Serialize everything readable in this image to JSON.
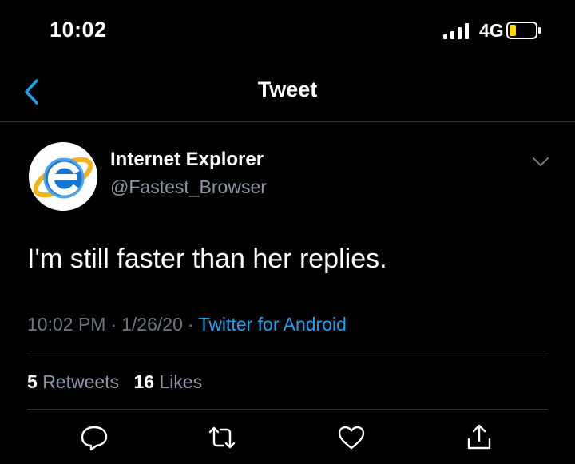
{
  "status_bar": {
    "time": "10:02",
    "network": "4G"
  },
  "nav": {
    "title": "Tweet"
  },
  "tweet": {
    "author_name": "Internet Explorer",
    "author_handle": "@Fastest_Browser",
    "text": "I'm still faster than her replies.",
    "time": "10:02 PM",
    "separator": "·",
    "date": "1/26/20",
    "source": "Twitter for Android"
  },
  "stats": {
    "retweets_count": "5",
    "retweets_label": "Retweets",
    "likes_count": "16",
    "likes_label": "Likes"
  },
  "colors": {
    "background": "#000000",
    "accent": "#1da1f2",
    "secondary_text": "#8b98a5",
    "battery_fill": "#ffd60a"
  },
  "icons": [
    "chevron-left-icon",
    "chevron-down-icon",
    "reply-icon",
    "retweet-icon",
    "heart-icon",
    "share-icon"
  ]
}
